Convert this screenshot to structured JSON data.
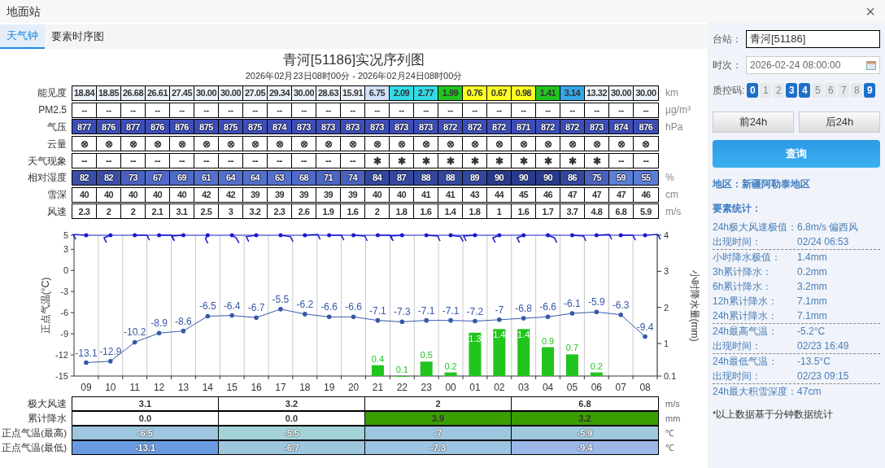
{
  "window": {
    "title": "地面站",
    "close": "×"
  },
  "tabs": [
    {
      "label": "天气钟",
      "selected": true
    },
    {
      "label": "要素时序图",
      "selected": false
    }
  ],
  "chart_title": "青河[51186]实况序列图",
  "chart_subtitle": "2026年02月23日08时00分 - 2026年02月24日08时00分",
  "element_table": [
    {
      "label": "能见度",
      "unit": "km",
      "kind": "colored",
      "cells": [
        {
          "text": "18.84",
          "color": "#eef3fb"
        },
        {
          "text": "18.85",
          "color": "#eef3fb"
        },
        {
          "text": "26.68",
          "color": "#eef3fb"
        },
        {
          "text": "26.61",
          "color": "#eef3fb"
        },
        {
          "text": "27.45",
          "color": "#eef3fb"
        },
        {
          "text": "30.00",
          "color": "#eef3fb"
        },
        {
          "text": "30.00",
          "color": "#eef3fb"
        },
        {
          "text": "27.05",
          "color": "#eef3fb"
        },
        {
          "text": "29.34",
          "color": "#eef3fb"
        },
        {
          "text": "30.00",
          "color": "#eef3fb"
        },
        {
          "text": "28.63",
          "color": "#eef3fb"
        },
        {
          "text": "15.91",
          "color": "#eef3fb"
        },
        {
          "text": "6.75",
          "color": "#cfe2f7"
        },
        {
          "text": "2.09",
          "color": "#33dbe8"
        },
        {
          "text": "2.77",
          "color": "#33dbe8"
        },
        {
          "text": "1.99",
          "color": "#22c41e"
        },
        {
          "text": "0.76",
          "color": "#ffff24"
        },
        {
          "text": "0.67",
          "color": "#ffff24"
        },
        {
          "text": "0.98",
          "color": "#ffff24"
        },
        {
          "text": "1.41",
          "color": "#22c41e"
        },
        {
          "text": "3.14",
          "color": "#35a8ea"
        },
        {
          "text": "13.32",
          "color": "#eef3fb"
        },
        {
          "text": "30.00",
          "color": "#eef3fb"
        },
        {
          "text": "30.00",
          "color": "#eef3fb"
        }
      ]
    },
    {
      "label": "PM2.5",
      "unit": "µg/m³",
      "kind": "plain",
      "cells": [
        {
          "text": "--"
        },
        {
          "text": "--"
        },
        {
          "text": "--"
        },
        {
          "text": "--"
        },
        {
          "text": "--"
        },
        {
          "text": "--"
        },
        {
          "text": "--"
        },
        {
          "text": "--"
        },
        {
          "text": "--"
        },
        {
          "text": "--"
        },
        {
          "text": "--"
        },
        {
          "text": "--"
        },
        {
          "text": "--"
        },
        {
          "text": "--"
        },
        {
          "text": "--"
        },
        {
          "text": "--"
        },
        {
          "text": "--"
        },
        {
          "text": "--"
        },
        {
          "text": "--"
        },
        {
          "text": "--"
        },
        {
          "text": "--"
        },
        {
          "text": "--"
        },
        {
          "text": "--"
        },
        {
          "text": "--"
        }
      ]
    },
    {
      "label": "气压",
      "unit": "hPa",
      "kind": "pressure",
      "cells": [
        {
          "text": "877"
        },
        {
          "text": "876"
        },
        {
          "text": "877"
        },
        {
          "text": "876"
        },
        {
          "text": "876"
        },
        {
          "text": "875"
        },
        {
          "text": "875"
        },
        {
          "text": "875"
        },
        {
          "text": "874"
        },
        {
          "text": "873"
        },
        {
          "text": "873"
        },
        {
          "text": "873"
        },
        {
          "text": "873"
        },
        {
          "text": "873"
        },
        {
          "text": "873"
        },
        {
          "text": "872"
        },
        {
          "text": "872"
        },
        {
          "text": "872"
        },
        {
          "text": "871"
        },
        {
          "text": "872"
        },
        {
          "text": "872"
        },
        {
          "text": "873"
        },
        {
          "text": "874"
        },
        {
          "text": "876"
        }
      ]
    },
    {
      "label": "云量",
      "kind": "symbol",
      "cells": [
        {
          "text": "⊗"
        },
        {
          "text": "⊗"
        },
        {
          "text": "⊗"
        },
        {
          "text": "⊗"
        },
        {
          "text": "⊗"
        },
        {
          "text": "⊗"
        },
        {
          "text": "⊗"
        },
        {
          "text": "⊗"
        },
        {
          "text": "⊗"
        },
        {
          "text": "⊗"
        },
        {
          "text": "⊗"
        },
        {
          "text": "⊗"
        },
        {
          "text": "⊗"
        },
        {
          "text": "⊗"
        },
        {
          "text": "⊗"
        },
        {
          "text": "⊗"
        },
        {
          "text": "⊗"
        },
        {
          "text": "⊗"
        },
        {
          "text": "⊗"
        },
        {
          "text": "⊗"
        },
        {
          "text": "⊗"
        },
        {
          "text": "⊗"
        },
        {
          "text": "⊗"
        },
        {
          "text": "⊗"
        }
      ]
    },
    {
      "label": "天气现象",
      "kind": "symbol",
      "cells": [
        {
          "text": "--"
        },
        {
          "text": "--"
        },
        {
          "text": "--"
        },
        {
          "text": "--"
        },
        {
          "text": "--"
        },
        {
          "text": "--"
        },
        {
          "text": "--"
        },
        {
          "text": "--"
        },
        {
          "text": "--"
        },
        {
          "text": "--"
        },
        {
          "text": "--"
        },
        {
          "text": "--"
        },
        {
          "text": "✱"
        },
        {
          "text": "✱"
        },
        {
          "text": "✱"
        },
        {
          "text": "✱"
        },
        {
          "text": "✱"
        },
        {
          "text": "✱"
        },
        {
          "text": "✱"
        },
        {
          "text": "✱"
        },
        {
          "text": "✱"
        },
        {
          "text": "✱"
        },
        {
          "text": "--"
        },
        {
          "text": "--"
        }
      ]
    },
    {
      "label": "相对湿度",
      "unit": "%",
      "kind": "shaded",
      "cells": [
        {
          "text": "82",
          "color": "#3a4ea6"
        },
        {
          "text": "82",
          "color": "#3a4ea6"
        },
        {
          "text": "73",
          "color": "#4a62bd"
        },
        {
          "text": "67",
          "color": "#4f6ac8"
        },
        {
          "text": "69",
          "color": "#4f6ac8"
        },
        {
          "text": "61",
          "color": "#5470cc"
        },
        {
          "text": "64",
          "color": "#5470cc"
        },
        {
          "text": "64",
          "color": "#5470cc"
        },
        {
          "text": "63",
          "color": "#5470cc"
        },
        {
          "text": "68",
          "color": "#4f6ac8"
        },
        {
          "text": "71",
          "color": "#4c66c2"
        },
        {
          "text": "74",
          "color": "#4a62bd"
        },
        {
          "text": "84",
          "color": "#34479e"
        },
        {
          "text": "87",
          "color": "#34479e"
        },
        {
          "text": "88",
          "color": "#34479e"
        },
        {
          "text": "88",
          "color": "#34479e"
        },
        {
          "text": "89",
          "color": "#34479e"
        },
        {
          "text": "90",
          "color": "#2a3a8a"
        },
        {
          "text": "90",
          "color": "#2a3a8a"
        },
        {
          "text": "90",
          "color": "#2a3a8a"
        },
        {
          "text": "86",
          "color": "#34479e"
        },
        {
          "text": "75",
          "color": "#4a62bd"
        },
        {
          "text": "59",
          "color": "#5a7fd6"
        },
        {
          "text": "55",
          "color": "#5a7fd6"
        }
      ]
    },
    {
      "label": "雪深",
      "unit": "cm",
      "kind": "plain",
      "cells": [
        {
          "text": "40"
        },
        {
          "text": "40"
        },
        {
          "text": "40"
        },
        {
          "text": "40"
        },
        {
          "text": "40"
        },
        {
          "text": "42"
        },
        {
          "text": "42"
        },
        {
          "text": "39"
        },
        {
          "text": "39"
        },
        {
          "text": "39"
        },
        {
          "text": "39"
        },
        {
          "text": "39"
        },
        {
          "text": "40"
        },
        {
          "text": "40"
        },
        {
          "text": "41"
        },
        {
          "text": "41"
        },
        {
          "text": "43"
        },
        {
          "text": "44"
        },
        {
          "text": "45"
        },
        {
          "text": "46"
        },
        {
          "text": "47"
        },
        {
          "text": "47"
        },
        {
          "text": "47"
        },
        {
          "text": "46"
        }
      ]
    },
    {
      "label": "风速",
      "unit": "m/s",
      "kind": "plain",
      "cells": [
        {
          "text": "2.3"
        },
        {
          "text": "2"
        },
        {
          "text": "2"
        },
        {
          "text": "2.1"
        },
        {
          "text": "3.1"
        },
        {
          "text": "2.5"
        },
        {
          "text": "3"
        },
        {
          "text": "3.2"
        },
        {
          "text": "2.3"
        },
        {
          "text": "2.6"
        },
        {
          "text": "1.9"
        },
        {
          "text": "1.6"
        },
        {
          "text": "2"
        },
        {
          "text": "1.8"
        },
        {
          "text": "1.6"
        },
        {
          "text": "1.4"
        },
        {
          "text": "1.8"
        },
        {
          "text": "1"
        },
        {
          "text": "1.6"
        },
        {
          "text": "1.7"
        },
        {
          "text": "3.7"
        },
        {
          "text": "4.8"
        },
        {
          "text": "6.8"
        },
        {
          "text": "5.9"
        }
      ]
    }
  ],
  "chart_data": {
    "type": "bar",
    "ylabel": "正点气温(°C)",
    "y2label": "小时降水量(mm)",
    "categories": [
      "09",
      "10",
      "11",
      "12",
      "13",
      "14",
      "15",
      "16",
      "17",
      "18",
      "19",
      "20",
      "21",
      "22",
      "23",
      "00",
      "01",
      "02",
      "03",
      "04",
      "05",
      "06",
      "07",
      "08"
    ],
    "ylim": [
      -15,
      5
    ],
    "yticks": [
      5,
      3,
      0,
      -3,
      -6,
      -9,
      -12,
      -15
    ],
    "y2lim": [
      0.1,
      4
    ],
    "y2ticks": [
      4,
      3,
      2,
      1,
      0.1
    ],
    "data_labels": true,
    "series": [
      {
        "type": "line",
        "color": "#3558a8",
        "values": [
          -13.1,
          -12.9,
          -10.2,
          -8.9,
          -8.6,
          -6.5,
          -6.4,
          -6.7,
          -5.5,
          -6.2,
          -6.6,
          -6.6,
          -7.1,
          -7.3,
          -7.1,
          -7.1,
          -7.2,
          -7,
          -6.8,
          -6.6,
          -6.1,
          -5.9,
          -6.3,
          -9.4
        ]
      },
      {
        "type": "bar",
        "axis": "y2",
        "color": "#22c41e",
        "values": [
          null,
          null,
          null,
          null,
          null,
          null,
          null,
          null,
          null,
          null,
          null,
          null,
          0.4,
          0.1,
          0.5,
          0.2,
          1.3,
          1.4,
          1.4,
          0.9,
          0.7,
          0.2,
          null,
          null
        ]
      }
    ]
  },
  "summary_table": [
    {
      "label": "极大风速",
      "unit": "m/s",
      "cells": [
        {
          "text": "3.1",
          "color": "#ffffff"
        },
        {
          "text": "3.2",
          "color": "#ffffff"
        },
        {
          "text": "2",
          "color": "#ffffff"
        },
        {
          "text": "6.8",
          "color": "#ffffff"
        }
      ]
    },
    {
      "label": "累计降水",
      "unit": "mm",
      "cells": [
        {
          "text": "0.0",
          "color": "#ffffff"
        },
        {
          "text": "0.0",
          "color": "#ffffff"
        },
        {
          "text": "3.9",
          "color": "#3a9e00"
        },
        {
          "text": "3.2",
          "color": "#3a9e00"
        }
      ]
    },
    {
      "label": "正点气温(最高)",
      "unit": "℃",
      "cells": [
        {
          "text": "-6.5",
          "color": "#9ec6de"
        },
        {
          "text": "-5.5",
          "color": "#a3d3d8"
        },
        {
          "text": "-7",
          "color": "#9ec6de"
        },
        {
          "text": "-5.9",
          "color": "#a0c8df"
        }
      ]
    },
    {
      "label": "正点气温(最低)",
      "unit": "℃",
      "cells": [
        {
          "text": "-13.1",
          "color": "#6a9be0"
        },
        {
          "text": "-6.7",
          "color": "#9ec6de"
        },
        {
          "text": "-7.3",
          "color": "#9dc4e0"
        },
        {
          "text": "-9.4",
          "color": "#9cb8e8"
        }
      ]
    }
  ],
  "side_panel": {
    "station": {
      "label": "台站：",
      "value": "青河[51186]"
    },
    "time": {
      "label": "时次：",
      "value": "2026-02-24 08:00:00"
    },
    "qc": {
      "label": "质控码:",
      "codes": [
        {
          "text": "0",
          "selected": true
        },
        {
          "text": "1",
          "selected": false
        },
        {
          "text": "2",
          "selected": false
        },
        {
          "text": "3",
          "selected": true
        },
        {
          "text": "4",
          "selected": true
        },
        {
          "text": "5",
          "selected": false
        },
        {
          "text": "6",
          "selected": false
        },
        {
          "text": "7",
          "selected": false
        },
        {
          "text": "8",
          "selected": false
        },
        {
          "text": "9",
          "selected": true
        }
      ]
    },
    "prev_button": "前24h",
    "next_button": "后24h",
    "query_button": "查询",
    "region": "地区：新疆阿勒泰地区",
    "stats_title": "要素统计：",
    "stats": [
      [
        {
          "label": "24h极大风速极值：",
          "value": "6.8m/s 偏西风",
          "wide": true
        },
        {
          "label": "出现时间：",
          "value": "02/24 06:53"
        }
      ],
      [
        {
          "label": "小时降水极值：",
          "value": "1.4mm"
        },
        {
          "label": "3h累计降水：",
          "value": "0.2mm"
        },
        {
          "label": "6h累计降水：",
          "value": "3.2mm"
        },
        {
          "label": "12h累计降水：",
          "value": "7.1mm"
        },
        {
          "label": "24h累计降水：",
          "value": "7.1mm"
        }
      ],
      [
        {
          "label": "24h最高气温：",
          "value": "-5.2°C"
        },
        {
          "label": "出现时间：",
          "value": "02/23 16:49"
        }
      ],
      [
        {
          "label": "24h最低气温：",
          "value": "-13.5°C"
        },
        {
          "label": "出现时间：",
          "value": "02/23 09:15"
        }
      ],
      [
        {
          "label": "24h最大积雪深度：",
          "value": "47cm",
          "wide": true
        }
      ]
    ],
    "note": "*以上数据基于分钟数据统计"
  }
}
